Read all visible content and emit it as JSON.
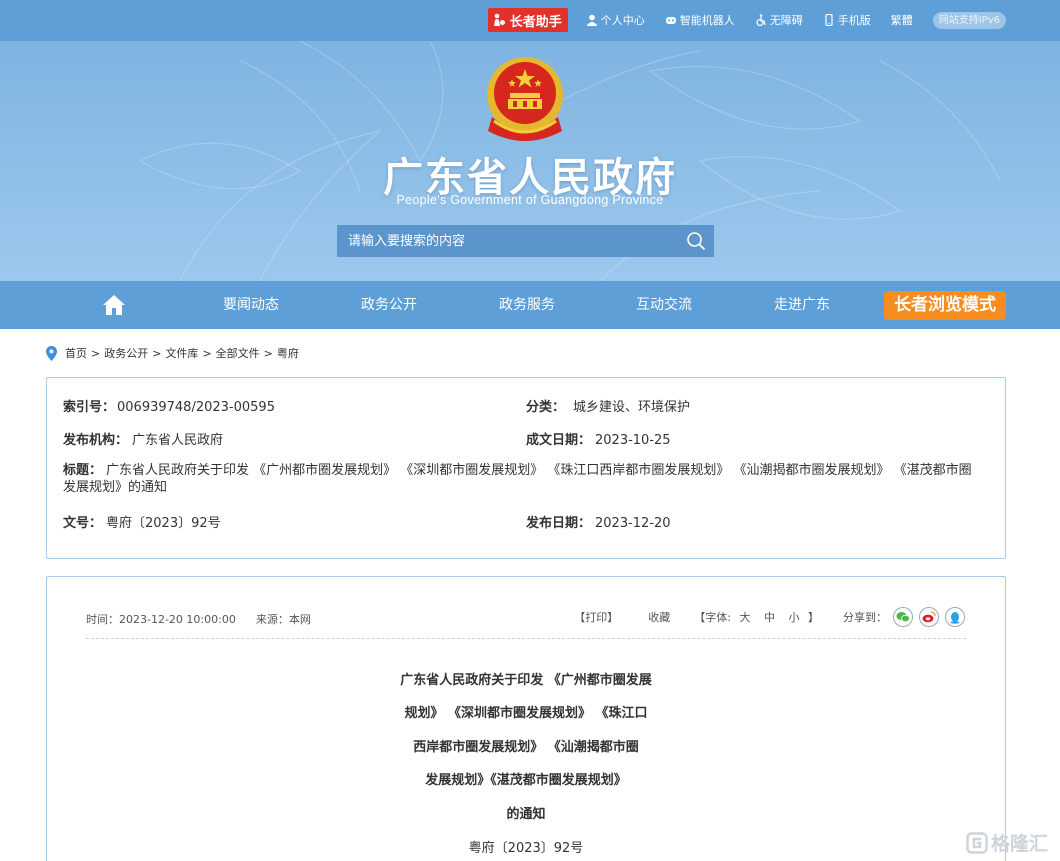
{
  "topbar": {
    "elder_helper": "长者助手",
    "personal_center": "个人中心",
    "smart_robot": "智能机器人",
    "accessibility": "无障碍",
    "mobile": "手机版",
    "traditional": "繁體",
    "ipv6": "网站支持IPv6"
  },
  "header": {
    "title": "广东省人民政府",
    "subtitle": "People's Government of Guangdong Province",
    "search_placeholder": "请输入要搜索的内容"
  },
  "nav": {
    "items": [
      "要闻动态",
      "政务公开",
      "政务服务",
      "互动交流",
      "走进广东"
    ],
    "elder_mode": "长者浏览模式"
  },
  "breadcrumb": [
    "首页",
    "政务公开",
    "文件库",
    "全部文件",
    "粤府"
  ],
  "meta": {
    "index_label": "索引号：",
    "index_value": "006939748/2023-00595",
    "category_label": "分类：",
    "category_value": "城乡建设、环境保护",
    "issuer_label": "发布机构：",
    "issuer_value": "广东省人民政府",
    "created_label": "成文日期：",
    "created_value": "2023-10-25",
    "title_label": "标题：",
    "title_value": "广东省人民政府关于印发 《广州都市圈发展规划》 《深圳都市圈发展规划》 《珠江口西岸都市圈发展规划》 《汕潮揭都市圈发展规划》 《湛茂都市圈发展规划》的通知",
    "docno_label": "文号：",
    "docno_value": "粤府〔2023〕92号",
    "published_label": "发布日期：",
    "published_value": "2023-12-20"
  },
  "article": {
    "time": "时间：2023-12-20 10:00:00",
    "source": "来源：本网",
    "print": "【打印】",
    "favorite": "收藏",
    "font_label": "【字体:",
    "font_large": "大",
    "font_medium": "中",
    "font_small": "小",
    "font_end": "】",
    "share_label": "分享到：",
    "title_lines": [
      "广东省人民政府关于印发 《广州都市圈发展",
      "规划》 《深圳都市圈发展规划》 《珠江口",
      "西岸都市圈发展规划》 《汕潮揭都市圈",
      "发展规划》《湛茂都市圈发展规划》",
      "的通知"
    ],
    "doc_number": "粤府〔2023〕92号"
  },
  "watermark": "格隆汇",
  "colors": {
    "nav_blue": "#5e9fd7",
    "elder_red": "#e23128",
    "elder_orange": "#f78c1f",
    "border_blue": "#a9cbe8"
  }
}
